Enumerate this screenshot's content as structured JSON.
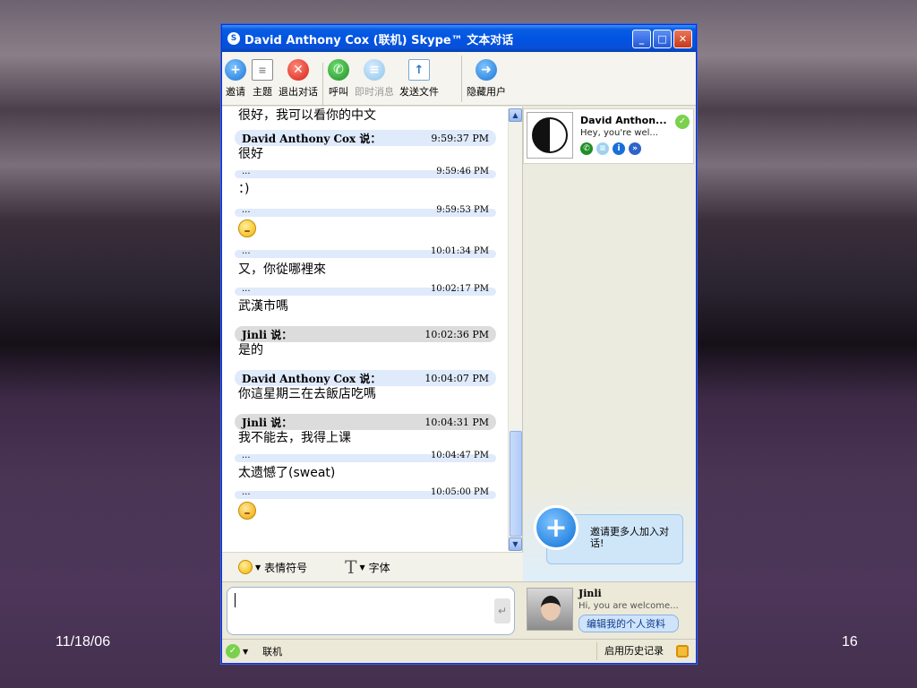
{
  "slide": {
    "date": "11/18/06",
    "page_number": "16"
  },
  "window": {
    "title": "David Anthony Cox (联机) Skype™ 文本对话",
    "minimize": "_",
    "maximize": "□",
    "close": "✕"
  },
  "toolbar": {
    "invite": "邀请",
    "topic": "主题",
    "leave": "退出对话",
    "call": "呼叫",
    "im": "即时消息",
    "send_file": "发送文件",
    "hide_users": "隐藏用户"
  },
  "chat": {
    "messages": [
      {
        "text": "很好，我可以看你的中文"
      },
      {
        "sender": "David Anthony Cox 说：",
        "time": "9:59:37 PM",
        "text": "很好"
      },
      {
        "sender": "...",
        "time": "9:59:46 PM",
        "text": "：)"
      },
      {
        "sender": "...",
        "time": "9:59:53 PM",
        "emoticon": "smile"
      },
      {
        "sender": "...",
        "time": "10:01:34 PM",
        "text": "又，你從哪裡來"
      },
      {
        "sender": "...",
        "time": "10:02:17 PM",
        "text": "武漢市嗎"
      },
      {
        "sender": "Jinli 说：",
        "time": "10:02:36 PM",
        "text": "是的"
      },
      {
        "sender": "David Anthony Cox 说：",
        "time": "10:04:07 PM",
        "text": "你這星期三在去飯店吃嗎"
      },
      {
        "sender": "Jinli 说：",
        "time": "10:04:31 PM",
        "text": "我不能去，我得上课"
      },
      {
        "sender": "...",
        "time": "10:04:47 PM",
        "text": "太遗憾了(sweat)"
      },
      {
        "sender": "...",
        "time": "10:05:00 PM",
        "emoticon": "sweat"
      }
    ],
    "emoticons_label": "表情符号",
    "font_label": "字体",
    "font_glyph": "T"
  },
  "contact": {
    "name": "David Anthon...",
    "mood": "Hey, you're wel..."
  },
  "invite": {
    "text": "邀请更多人加入对话!"
  },
  "me": {
    "name": "Jinli",
    "mood": "Hi, you are welcome...",
    "edit_profile": "编辑我的个人资料"
  },
  "statusbar": {
    "status": "联机",
    "history": "启用历史记录"
  }
}
